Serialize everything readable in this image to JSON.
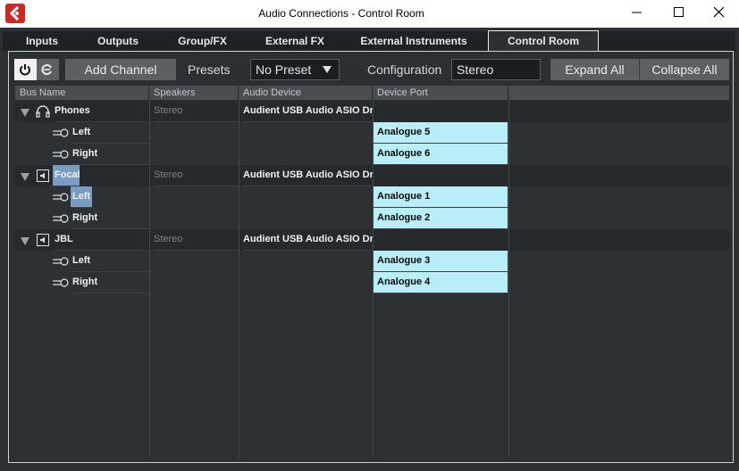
{
  "window": {
    "title": "Audio Connections - Control Room"
  },
  "tabs": [
    {
      "label": "Inputs",
      "active": false
    },
    {
      "label": "Outputs",
      "active": false
    },
    {
      "label": "Group/FX",
      "active": false
    },
    {
      "label": "External FX",
      "active": false
    },
    {
      "label": "External Instruments",
      "active": false
    },
    {
      "label": "Control Room",
      "active": true
    }
  ],
  "toolbar": {
    "power_icon": "power-icon",
    "reset_icon": "reset-icon",
    "add_channel_label": "Add Channel",
    "presets_label": "Presets",
    "preset_value": "No Preset",
    "configuration_label": "Configuration",
    "configuration_value": "Stereo",
    "expand_all_label": "Expand All",
    "collapse_all_label": "Collapse All"
  },
  "columns": [
    "Bus Name",
    "Speakers",
    "Audio Device",
    "Device Port"
  ],
  "rows": [
    {
      "type": "parent",
      "name": "Phones",
      "icon": "headphones-icon",
      "speakers": "Stereo",
      "device": "Audient USB Audio ASIO Driver",
      "port": ""
    },
    {
      "type": "child",
      "name": "Left",
      "icon": "output-port-icon",
      "speakers": "",
      "device": "",
      "port": "Analogue 5"
    },
    {
      "type": "child",
      "name": "Right",
      "icon": "output-port-icon",
      "speakers": "",
      "device": "",
      "port": "Analogue 6"
    },
    {
      "type": "parent",
      "name": "Focal",
      "icon": "speaker-icon",
      "speakers": "Stereo",
      "device": "Audient USB Audio ASIO Driver",
      "port": "",
      "highlight": true
    },
    {
      "type": "child",
      "name": "Left",
      "icon": "output-port-icon",
      "speakers": "",
      "device": "",
      "port": "Analogue 1",
      "highlight": true
    },
    {
      "type": "child",
      "name": "Right",
      "icon": "output-port-icon",
      "speakers": "",
      "device": "",
      "port": "Analogue 2"
    },
    {
      "type": "parent",
      "name": "JBL",
      "icon": "speaker-icon",
      "speakers": "Stereo",
      "device": "Audient USB Audio ASIO Driver",
      "port": ""
    },
    {
      "type": "child",
      "name": "Left",
      "icon": "output-port-icon",
      "speakers": "",
      "device": "",
      "port": "Analogue 3"
    },
    {
      "type": "child",
      "name": "Right",
      "icon": "output-port-icon",
      "speakers": "",
      "device": "",
      "port": "Analogue 4"
    }
  ],
  "colors": {
    "port_highlight": "#b9eef8",
    "selection": "#7a9cc0",
    "logo_red": "#c42b2b"
  }
}
